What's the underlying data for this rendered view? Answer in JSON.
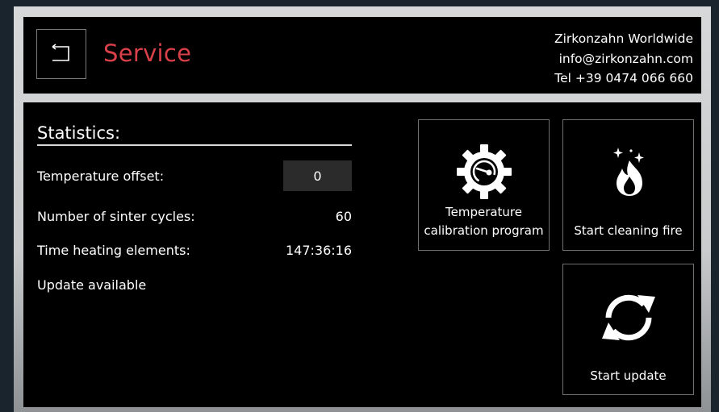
{
  "header": {
    "back_icon": "back-arrow-icon",
    "title": "Service",
    "contact": {
      "company": "Zirkonzahn Worldwide",
      "email": "info@zirkonzahn.com",
      "phone": "Tel +39 0474 066 660"
    }
  },
  "statistics": {
    "heading": "Statistics:",
    "temperature_offset_label": "Temperature offset:",
    "temperature_offset_value": "0",
    "sinter_cycles_label": "Number of sinter cycles:",
    "sinter_cycles_value": "60",
    "heating_time_label": "Time heating elements:",
    "heating_time_value": "147:36:16",
    "update_status": "Update available"
  },
  "actions": {
    "calibration": {
      "line1": "Temperature",
      "line2": "calibration program",
      "icon": "gear-gauge-icon"
    },
    "cleaning": {
      "label": "Start cleaning fire",
      "icon": "fire-sparkle-icon"
    },
    "update": {
      "label": "Start update",
      "icon": "refresh-icon"
    }
  },
  "colors": {
    "title_red": "#d9404a",
    "panel_bg": "#000000",
    "bezel": "#d6d8d9",
    "field_bg": "#2b2b2b"
  }
}
